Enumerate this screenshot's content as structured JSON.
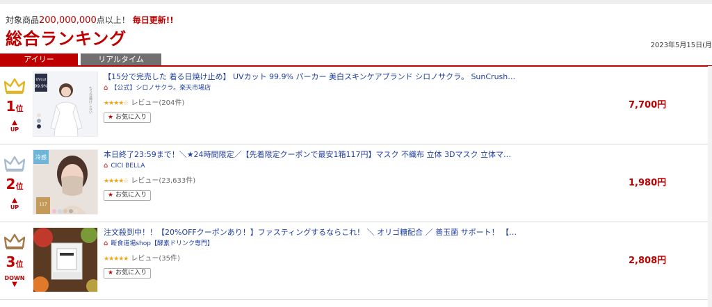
{
  "header": {
    "tagline_prefix": "対象商品",
    "tagline_count": "200,000,000",
    "tagline_suffix": "点以上！",
    "tagline_update": "毎日更新!!",
    "title": "総合ランキング",
    "date": "2023年5月15日(月"
  },
  "tabs": [
    {
      "label": "アイリー",
      "active": true
    },
    {
      "label": "リアルタイム",
      "active": false
    }
  ],
  "colors": {
    "accent": "#bf0000",
    "gold": "#e4b41f",
    "silver": "#a9bccf",
    "bronze": "#a47a4a"
  },
  "items": [
    {
      "rank": "1",
      "rank_suffix": "位",
      "trend": "UP",
      "crown": "gold",
      "name": "【15分で完売した 着る日焼け止め】 UVカット 99.9% パーカー 美白スキンケアブランド シロノサクラ。 SunCrush！UV h…",
      "shop": "【公式】シロノサクラ。楽天市場店",
      "stars": "★★★★☆",
      "rating": 4,
      "reviews": "レビュー(204件)",
      "fav_label": "お気に入り",
      "price": "7,700円",
      "thumb_badge": "UVcut 99.9%"
    },
    {
      "rank": "2",
      "rank_suffix": "位",
      "trend": "UP",
      "crown": "silver",
      "name": "本日終了23:59まで！＼★24時間限定／【先着限定クーポンで最安1箱117円】マスク 不織布 立体 3Dマスク 立体マスク 不…",
      "shop": "CICI BELLA",
      "stars": "★★★★☆",
      "rating": 4,
      "reviews": "レビュー(23,633件)",
      "fav_label": "お気に入り",
      "price": "1,980円",
      "thumb_badge": "冷感"
    },
    {
      "rank": "3",
      "rank_suffix": "位",
      "trend": "DOWN",
      "crown": "bronze",
      "name": "注文殺到中！！【20%OFFクーポンあり！】ファスティングするならこれ！ ＼ オリゴ糖配合 ／ 善玉菌 サポート！ 【ボ…",
      "shop": "断食道場shop【酵素ドリンク専門】",
      "stars": "★★★★★",
      "rating": 4.5,
      "reviews": "レビュー(35件)",
      "fav_label": "お気に入り",
      "price": "2,808円",
      "thumb_badge": ""
    }
  ]
}
